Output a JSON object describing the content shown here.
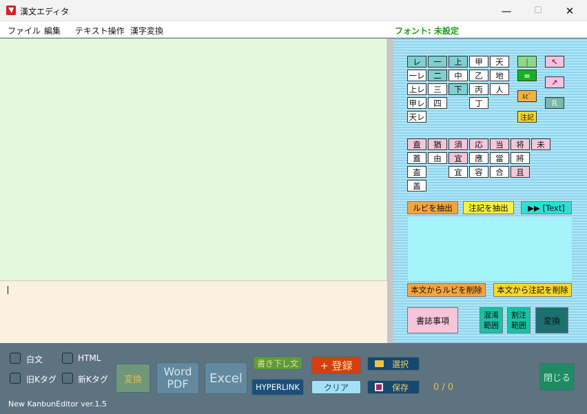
{
  "window": {
    "title": "漢文エディタ",
    "controls": {
      "minimize": "—",
      "maximize": "☐",
      "close": "✕"
    }
  },
  "menu": {
    "items": [
      "ファイル",
      "編集",
      "テキスト操作",
      "漢字変換"
    ],
    "font_status": "フォント: 未設定"
  },
  "editor": {
    "text": ""
  },
  "panel": {
    "kaeriten_rows": [
      [
        "レ",
        "一",
        "上",
        "甲",
        "天"
      ],
      [
        "一レ",
        "二",
        "中",
        "乙",
        "地"
      ],
      [
        "上レ",
        "三",
        "下",
        "丙",
        "人"
      ],
      [
        "甲レ",
        "四",
        "",
        "丁",
        ""
      ],
      [
        "天レ",
        "",
        "",
        "",
        ""
      ]
    ],
    "tools": {
      "bar": "|",
      "equals": "=",
      "ruby": "ﾙﾋﾞ",
      "note": "注記",
      "up_left": "↖",
      "up_right": "↗",
      "r": "R"
    },
    "saiduku_rows": [
      [
        "盍",
        "猶",
        "須",
        "応",
        "当",
        "将",
        "未"
      ],
      [
        "蓋",
        "由",
        "宜",
        "應",
        "當",
        "將",
        ""
      ],
      [
        "盇",
        "",
        "宜",
        "容",
        "合",
        "且",
        ""
      ],
      [
        "盖",
        "",
        "",
        "",
        "",
        "",
        ""
      ]
    ],
    "extract": {
      "ruby": "ルビを抽出",
      "note": "注記を抽出",
      "text": "▶▶ [Text]"
    },
    "remove": {
      "ruby": "本文からルビを削除",
      "note": "本文から注記を削除"
    },
    "actions": {
      "bibliography": "書誌事項",
      "kondoku": "混淆\n範囲",
      "warichu": "割注\n範囲",
      "convert": "変換"
    }
  },
  "bottom": {
    "checkboxes": {
      "hakubun": "白文",
      "html": "HTML",
      "old_k": "旧Kタグ",
      "new_k": "新Kタグ"
    },
    "buttons": {
      "convert": "変換",
      "word_pdf": "Word\nPDF",
      "excel": "Excel",
      "kakikudashi": "書き下し文",
      "hyperlink": "HYPERLINK",
      "register": "+ 登録",
      "clear": "クリア",
      "select": "選択",
      "save": "保存",
      "close": "閉じる"
    },
    "counter": "0 / 0",
    "version": "New KanbunEditor ver.1.5"
  },
  "colors": {
    "accent_green": "#18a018",
    "editor_bg": "#e3f8dd",
    "input_bg": "#faf1e0",
    "panel_stripe": "#8ed4ee"
  }
}
